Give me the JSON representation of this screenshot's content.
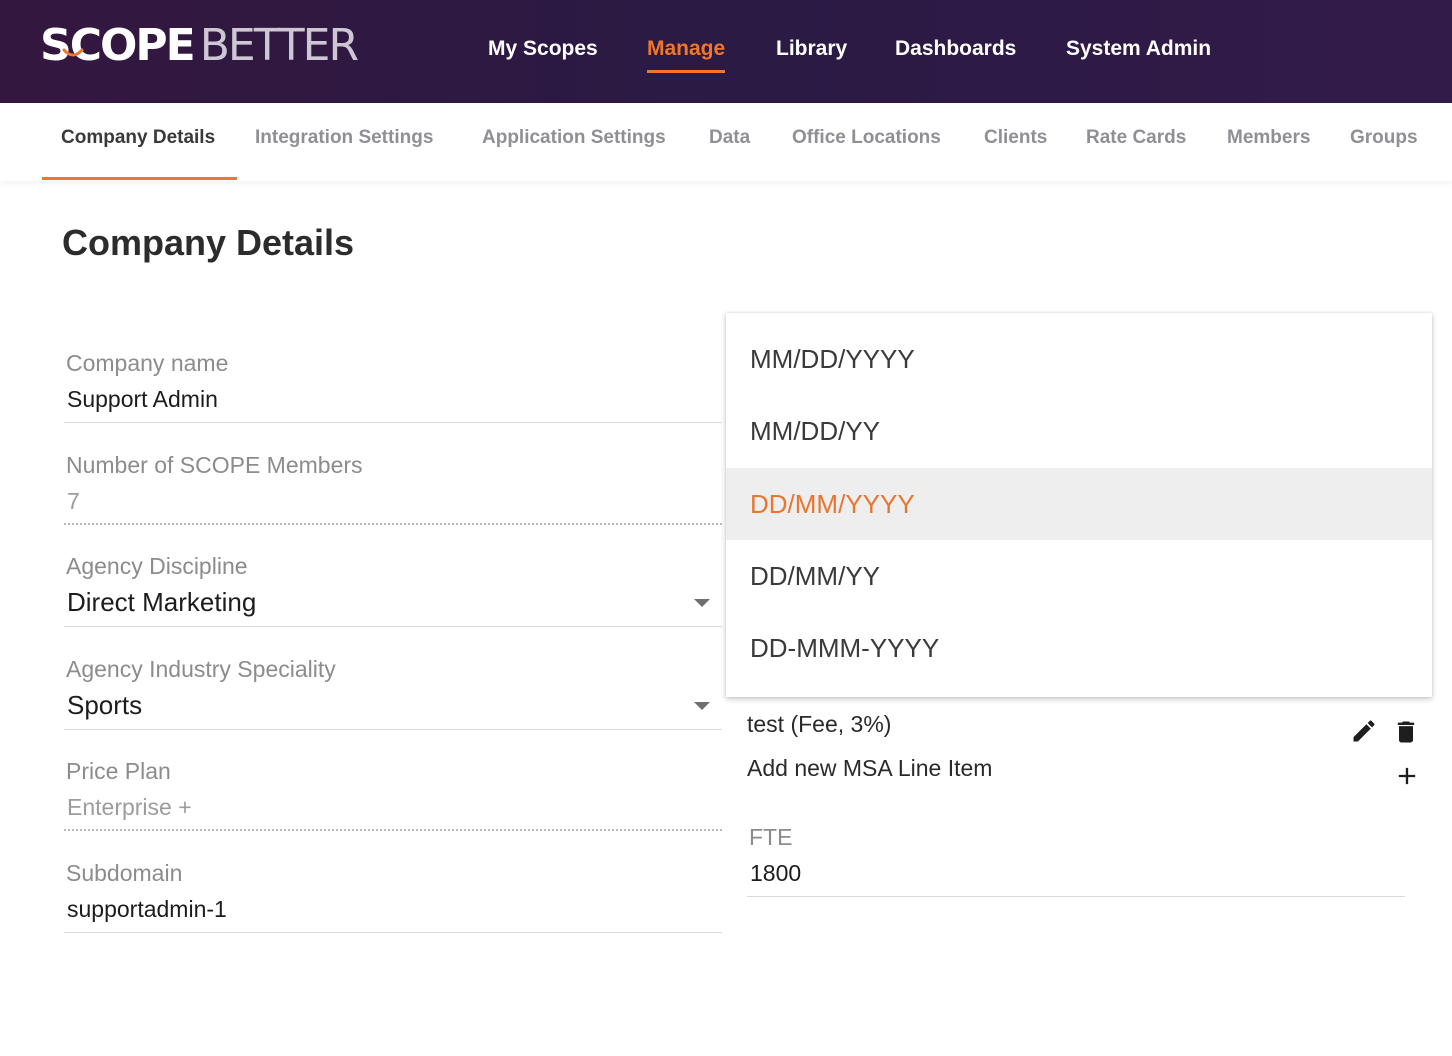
{
  "brand": {
    "logo_scope": "SCOPE",
    "logo_better": "BETTER"
  },
  "nav": {
    "items": [
      {
        "label": "My Scopes"
      },
      {
        "label": "Manage"
      },
      {
        "label": "Library"
      },
      {
        "label": "Dashboards"
      },
      {
        "label": "System Admin"
      }
    ],
    "active": "Manage"
  },
  "subtabs": {
    "items": [
      {
        "label": "Company Details"
      },
      {
        "label": "Integration Settings"
      },
      {
        "label": "Application Settings"
      },
      {
        "label": "Data"
      },
      {
        "label": "Office Locations"
      },
      {
        "label": "Clients"
      },
      {
        "label": "Rate Cards"
      },
      {
        "label": "Members"
      },
      {
        "label": "Groups"
      }
    ],
    "active": "Company Details"
  },
  "page": {
    "title": "Company Details"
  },
  "form": {
    "company_name": {
      "label": "Company name",
      "value": "Support Admin"
    },
    "scope_members": {
      "label": "Number of SCOPE Members",
      "value": "7"
    },
    "agency_discipline": {
      "label": "Agency Discipline",
      "value": "Direct Marketing"
    },
    "industry_speciality": {
      "label": "Agency Industry Speciality",
      "value": "Sports"
    },
    "price_plan": {
      "label": "Price Plan",
      "value": "Enterprise +"
    },
    "subdomain": {
      "label": "Subdomain",
      "value": "supportadmin-1"
    }
  },
  "date_format_menu": {
    "options": [
      {
        "label": "MM/DD/YYYY"
      },
      {
        "label": "MM/DD/YY"
      },
      {
        "label": "DD/MM/YYYY"
      },
      {
        "label": "DD/MM/YY"
      },
      {
        "label": "DD-MMM-YYYY"
      }
    ],
    "selected": "DD/MM/YYYY"
  },
  "msa": {
    "line_item": "test (Fee, 3%)",
    "add_label": "Add new MSA Line Item"
  },
  "fte": {
    "label": "FTE",
    "value": "1800"
  },
  "colors": {
    "accent": "#f0762b",
    "topbar": "#2d1944",
    "menu_selected_bg": "#eeeeee"
  },
  "icons": {
    "edit": "pencil-icon",
    "delete": "trash-icon",
    "add": "plus-icon",
    "dropdown": "caret-down-icon"
  }
}
